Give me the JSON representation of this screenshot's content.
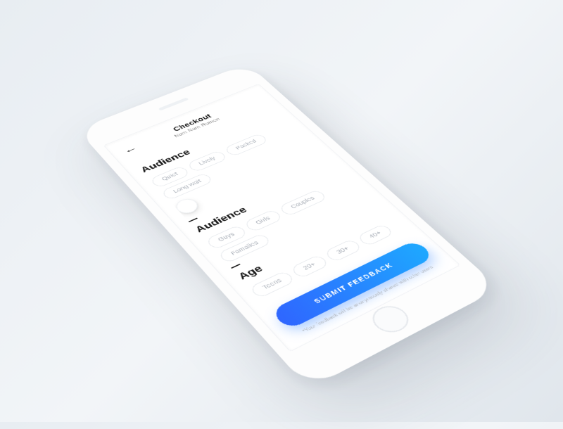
{
  "header": {
    "title": "Checkout",
    "subtitle": "Nom Nom Romen"
  },
  "sections": {
    "s0": {
      "title": "Audience",
      "chips": [
        "Quiet",
        "Lively",
        "Packed",
        "Long wait"
      ]
    },
    "s1": {
      "title": "Audience",
      "chips": [
        "Guys",
        "Girls",
        "Couples",
        "Famalies"
      ]
    },
    "s2": {
      "title": "Age",
      "chips": [
        "Teens",
        "20+",
        "30+",
        "40+"
      ]
    }
  },
  "submit_label": "SUBMIT FEEDBACK",
  "footnote": "*Your feedback will be anonymously shared with other users"
}
